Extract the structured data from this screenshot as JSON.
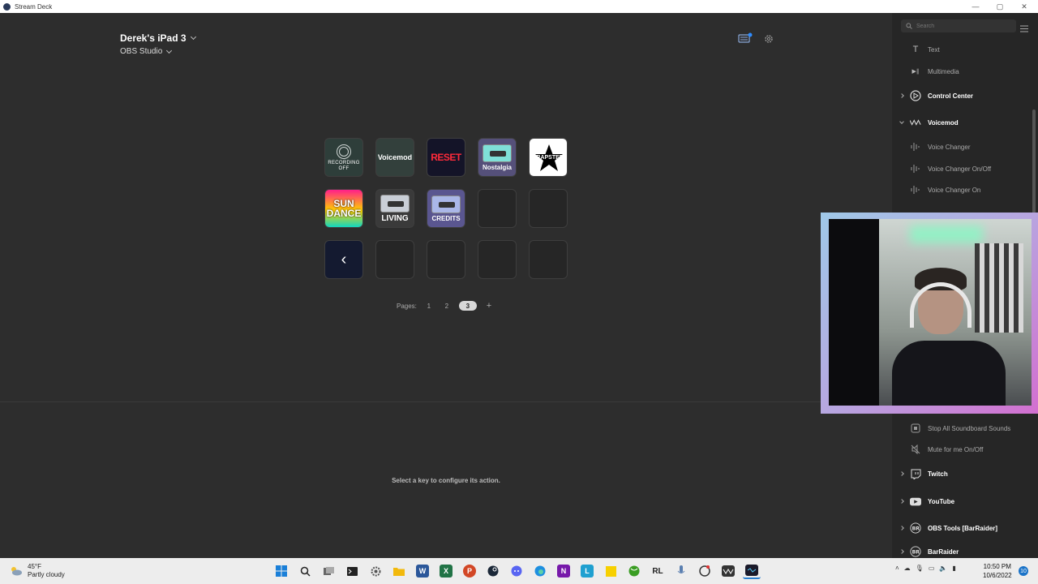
{
  "window": {
    "title": "Stream Deck",
    "minimize": "—",
    "maximize": "▢",
    "close": "✕"
  },
  "header": {
    "device": "Derek's iPad 3",
    "profile": "OBS Studio"
  },
  "keys": {
    "rec_label": "RECORDING OFF",
    "voicemod": "Voicemod",
    "reset": "RESET",
    "nostalgia": "Nostalgia",
    "trapster": "TRAPSTER",
    "sun_dance": "SUN DANCE",
    "living": "LIVING",
    "credits": "CREDITS",
    "back": "‹"
  },
  "pages": {
    "label": "Pages:",
    "items": [
      "1",
      "2",
      "3"
    ],
    "active": "3",
    "add": "+"
  },
  "hint": "Select a key to configure its action.",
  "sidebar": {
    "search_placeholder": "Search",
    "items": [
      {
        "label": "Text",
        "icon": "T"
      },
      {
        "label": "Multimedia",
        "icon": "▶∥"
      },
      {
        "label": "Control Center"
      },
      {
        "label": "Voicemod"
      },
      {
        "label": "Voice Changer"
      },
      {
        "label": "Voice Changer On/Off"
      },
      {
        "label": "Voice Changer On"
      },
      {
        "label": "Stop All Soundboard Sounds"
      },
      {
        "label": "Mute for me On/Off"
      },
      {
        "label": "Twitch"
      },
      {
        "label": "YouTube"
      },
      {
        "label": "OBS Tools [BarRaider]"
      },
      {
        "label": "BarRaider"
      }
    ]
  },
  "taskbar": {
    "temp": "45°F",
    "weather": "Partly cloudy",
    "time": "10:50 PM",
    "date": "10/6/2022",
    "notifications": "10"
  }
}
